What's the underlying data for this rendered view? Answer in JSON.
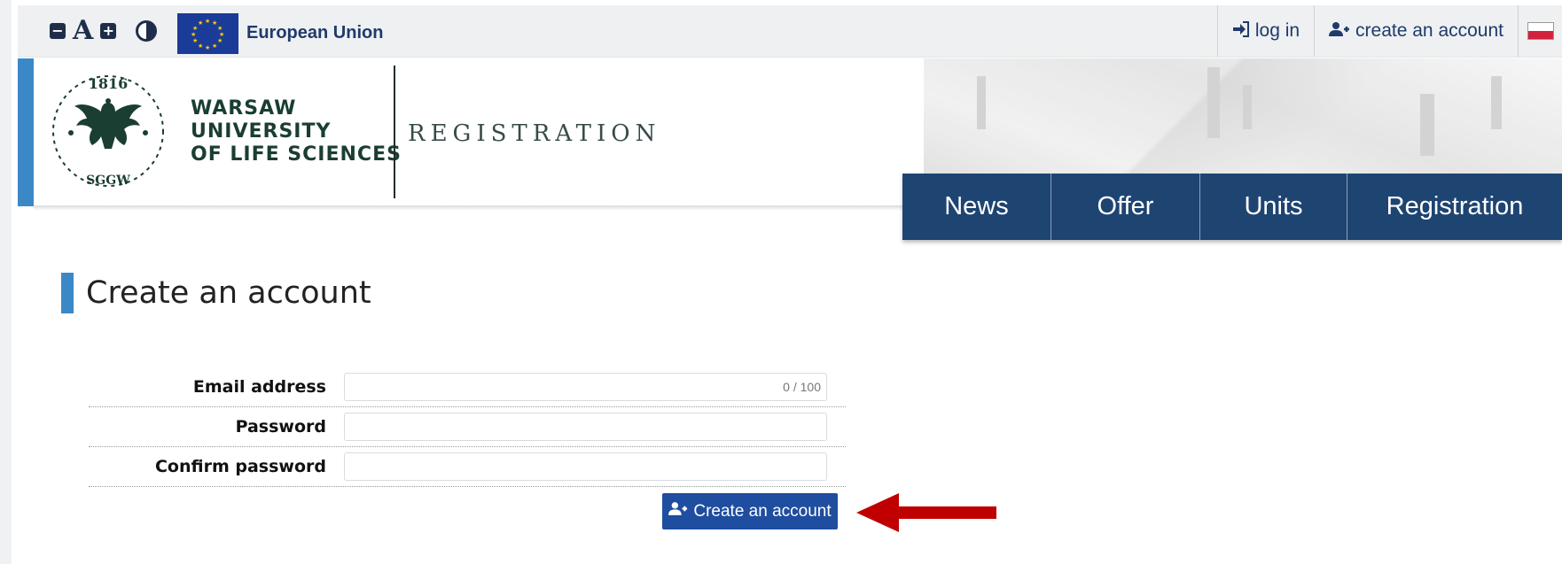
{
  "topbar": {
    "font_decrease_symbol": "−",
    "font_normal_symbol": "A",
    "font_increase_symbol": "+",
    "eu_label": "European Union",
    "login_label": "log in",
    "create_account_label": "create an account"
  },
  "header": {
    "seal_year": "1816",
    "seal_abbrev": "SGGW",
    "university_line1": "WARSAW",
    "university_line2": "UNIVERSITY",
    "university_line3": "OF LIFE SCIENCES",
    "site_title": "REGISTRATION"
  },
  "nav": {
    "items": [
      {
        "label": "News"
      },
      {
        "label": "Offer"
      },
      {
        "label": "Units"
      },
      {
        "label": "Registration"
      }
    ]
  },
  "main": {
    "heading": "Create an account",
    "form": {
      "email_label": "Email address",
      "email_value": "",
      "email_counter": "0 / 100",
      "password_label": "Password",
      "password_value": "",
      "confirm_label": "Confirm password",
      "confirm_value": "",
      "submit_label": "Create an account"
    }
  },
  "colors": {
    "accent_blue": "#3b88c7",
    "nav_blue": "#1e4472",
    "button_blue": "#1f4d9f",
    "annotation_arrow": "#c00000",
    "seal_green": "#1a3e31"
  },
  "icons": {
    "login": "sign-in-icon",
    "create_account": "user-plus-icon",
    "language": "poland-flag-icon",
    "contrast": "contrast-icon"
  }
}
